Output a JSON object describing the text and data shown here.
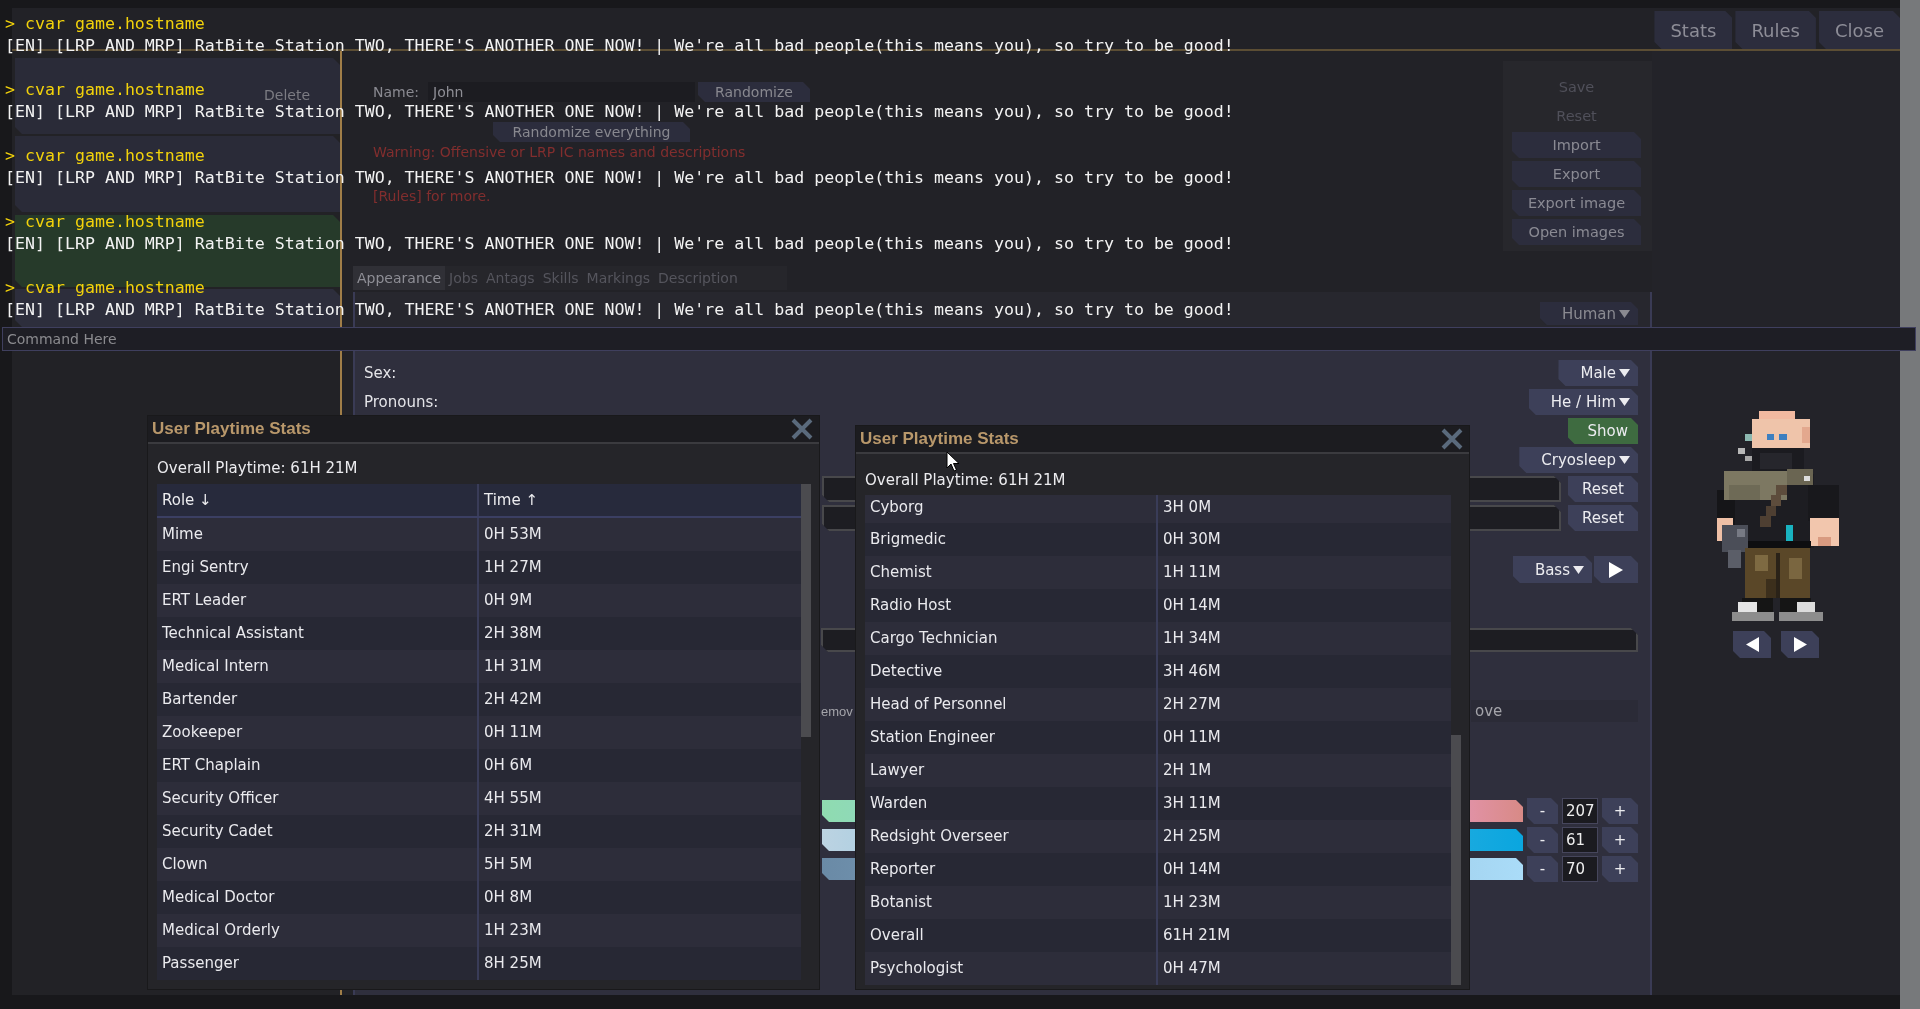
{
  "setup": {
    "header_buttons": [
      {
        "label": "Stats"
      },
      {
        "label": "Rules"
      },
      {
        "label": "Close"
      }
    ],
    "slots": [
      {
        "selected": false,
        "delete_label": "Delete"
      },
      {
        "selected": false
      },
      {
        "selected": true
      }
    ],
    "name": {
      "label": "Name:",
      "value": "John"
    },
    "randomize_button": "Randomize",
    "randomize_everything_button": "Randomize everything",
    "warning": {
      "first_line": "Warning: Offensive or LRP IC names and descriptions",
      "last_line": "[Rules] for more."
    },
    "profile_buttons": [
      {
        "label": "Save",
        "disabled": true
      },
      {
        "label": "Reset",
        "disabled": true
      },
      {
        "label": "Import",
        "disabled": false
      },
      {
        "label": "Export",
        "disabled": false
      },
      {
        "label": "Export image",
        "disabled": false
      },
      {
        "label": "Open images",
        "disabled": false
      }
    ],
    "tabs": [
      {
        "label": "Appearance",
        "selected": true
      },
      {
        "label": "Jobs",
        "selected": false
      },
      {
        "label": "Antags",
        "selected": false
      },
      {
        "label": "Skills",
        "selected": false
      },
      {
        "label": "Markings",
        "selected": false
      },
      {
        "label": "Description",
        "selected": false
      }
    ],
    "appearance": {
      "rows": [
        {
          "kind": "dropdown",
          "value": "Human"
        },
        {
          "kind": "dropdown",
          "label": "Sex:",
          "value": "Male"
        },
        {
          "kind": "dropdown",
          "label": "Pronouns:",
          "value": "He / Him"
        },
        {
          "kind": "toggle",
          "value": "Show",
          "on": true
        },
        {
          "kind": "dropdown",
          "value": "Cryosleep"
        },
        {
          "kind": "reset_field",
          "button": "Reset"
        },
        {
          "kind": "reset_field",
          "button": "Reset"
        },
        {
          "kind": "voice",
          "value": "Bass"
        },
        {
          "kind": "wide_field"
        },
        {
          "kind": "fragments",
          "left": "emov",
          "right": "ove"
        },
        {
          "kind": "hue_slider",
          "minus": "-",
          "value": "207",
          "plus": "+"
        },
        {
          "kind": "saturation_slider",
          "minus": "-",
          "value": "61",
          "plus": "+"
        },
        {
          "kind": "brightness_slider",
          "minus": "-",
          "value": "70",
          "plus": "+"
        }
      ]
    }
  },
  "console": {
    "lines": [
      {
        "kind": "command",
        "text": "> cvar game.hostname"
      },
      {
        "kind": "output",
        "text": "[EN] [LRP AND MRP] RatBite Station TWO, THERE'S ANOTHER ONE NOW! | We're all bad people(this means you), so try to be good!"
      },
      {
        "kind": "command",
        "text": "> cvar game.hostname"
      },
      {
        "kind": "output",
        "text": "[EN] [LRP AND MRP] RatBite Station TWO, THERE'S ANOTHER ONE NOW! | We're all bad people(this means you), so try to be good!"
      },
      {
        "kind": "command",
        "text": "> cvar game.hostname"
      },
      {
        "kind": "output",
        "text": "[EN] [LRP AND MRP] RatBite Station TWO, THERE'S ANOTHER ONE NOW! | We're all bad people(this means you), so try to be good!"
      },
      {
        "kind": "command",
        "text": "> cvar game.hostname"
      },
      {
        "kind": "output",
        "text": "[EN] [LRP AND MRP] RatBite Station TWO, THERE'S ANOTHER ONE NOW! | We're all bad people(this means you), so try to be good!"
      },
      {
        "kind": "command",
        "text": "> cvar game.hostname"
      },
      {
        "kind": "output",
        "text": "[EN] [LRP AND MRP] RatBite Station TWO, THERE'S ANOTHER ONE NOW! | We're all bad people(this means you), so try to be good!"
      }
    ],
    "input": {
      "placeholder": "Command Here"
    }
  },
  "playtime_windows": [
    {
      "title": "User Playtime Stats",
      "overall": "Overall Playtime: 61H 21M",
      "columns": [
        "Role ↓",
        "Time ↑"
      ],
      "scrolled_to_end": false,
      "rows": [
        {
          "role": "Mime",
          "time": "0H 53M"
        },
        {
          "role": "Engi Sentry",
          "time": "1H 27M"
        },
        {
          "role": "ERT Leader",
          "time": "0H 9M"
        },
        {
          "role": "Technical Assistant",
          "time": "2H 38M"
        },
        {
          "role": "Medical Intern",
          "time": "1H 31M"
        },
        {
          "role": "Bartender",
          "time": "2H 42M"
        },
        {
          "role": "Zookeeper",
          "time": "0H 11M"
        },
        {
          "role": "ERT Chaplain",
          "time": "0H 6M"
        },
        {
          "role": "Security Officer",
          "time": "4H 55M"
        },
        {
          "role": "Security Cadet",
          "time": "2H 31M"
        },
        {
          "role": "Clown",
          "time": "5H 5M"
        },
        {
          "role": "Medical Doctor",
          "time": "0H 8M"
        },
        {
          "role": "Medical Orderly",
          "time": "1H 23M"
        },
        {
          "role": "Passenger",
          "time": "8H 25M"
        }
      ]
    },
    {
      "title": "User Playtime Stats",
      "overall": "Overall Playtime: 61H 21M",
      "scrolled_to_end": true,
      "rows": [
        {
          "role": "Cyborg",
          "time": "3H 0M"
        },
        {
          "role": "Brigmedic",
          "time": "0H 30M"
        },
        {
          "role": "Chemist",
          "time": "1H 11M"
        },
        {
          "role": "Radio Host",
          "time": "0H 14M"
        },
        {
          "role": "Cargo Technician",
          "time": "1H 34M"
        },
        {
          "role": "Detective",
          "time": "3H 46M"
        },
        {
          "role": "Head of Personnel",
          "time": "2H 27M"
        },
        {
          "role": "Station Engineer",
          "time": "0H 11M"
        },
        {
          "role": "Lawyer",
          "time": "2H 1M"
        },
        {
          "role": "Warden",
          "time": "3H 11M"
        },
        {
          "role": "Redsight Overseer",
          "time": "2H 25M"
        },
        {
          "role": "Reporter",
          "time": "0H 14M"
        },
        {
          "role": "Botanist",
          "time": "1H 23M"
        },
        {
          "role": "Overall",
          "time": "61H 21M"
        },
        {
          "role": "Psychologist",
          "time": "0H 47M"
        }
      ]
    }
  ]
}
